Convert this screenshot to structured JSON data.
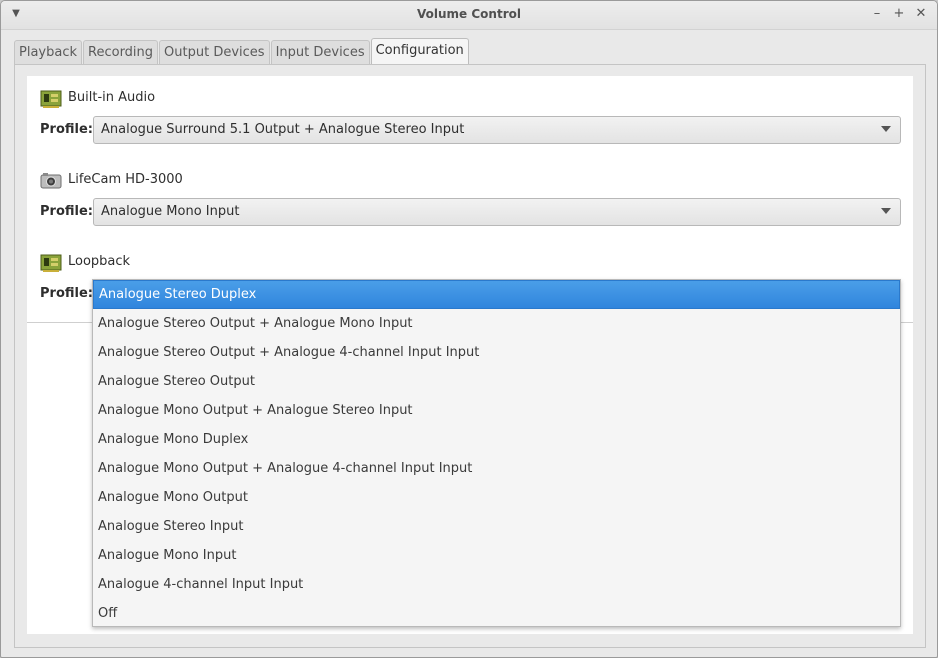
{
  "window": {
    "title": "Volume Control"
  },
  "tabs": [
    {
      "label": "Playback"
    },
    {
      "label": "Recording"
    },
    {
      "label": "Output Devices"
    },
    {
      "label": "Input Devices"
    },
    {
      "label": "Configuration"
    }
  ],
  "active_tab": "Configuration",
  "cards": [
    {
      "name": "Built-in Audio",
      "profile_label": "Profile:",
      "profile": "Analogue Surround 5.1 Output + Analogue Stereo Input",
      "icon": "sound-card-icon"
    },
    {
      "name": "LifeCam HD-3000",
      "profile_label": "Profile:",
      "profile": "Analogue Mono Input",
      "icon": "camera-icon"
    },
    {
      "name": "Loopback",
      "profile_label": "Profile:",
      "profile": "Analogue Stereo Duplex",
      "icon": "sound-card-icon"
    }
  ],
  "dropdown": {
    "selected": "Analogue Stereo Duplex",
    "options": [
      "Analogue Stereo Duplex",
      "Analogue Stereo Output + Analogue Mono Input",
      "Analogue Stereo Output + Analogue 4-channel Input Input",
      "Analogue Stereo Output",
      "Analogue Mono Output + Analogue Stereo Input",
      "Analogue Mono Duplex",
      "Analogue Mono Output + Analogue 4-channel Input Input",
      "Analogue Mono Output",
      "Analogue Stereo Input",
      "Analogue Mono Input",
      "Analogue 4-channel Input Input",
      "Off"
    ]
  },
  "colors": {
    "selection": "#3a8fe2"
  }
}
